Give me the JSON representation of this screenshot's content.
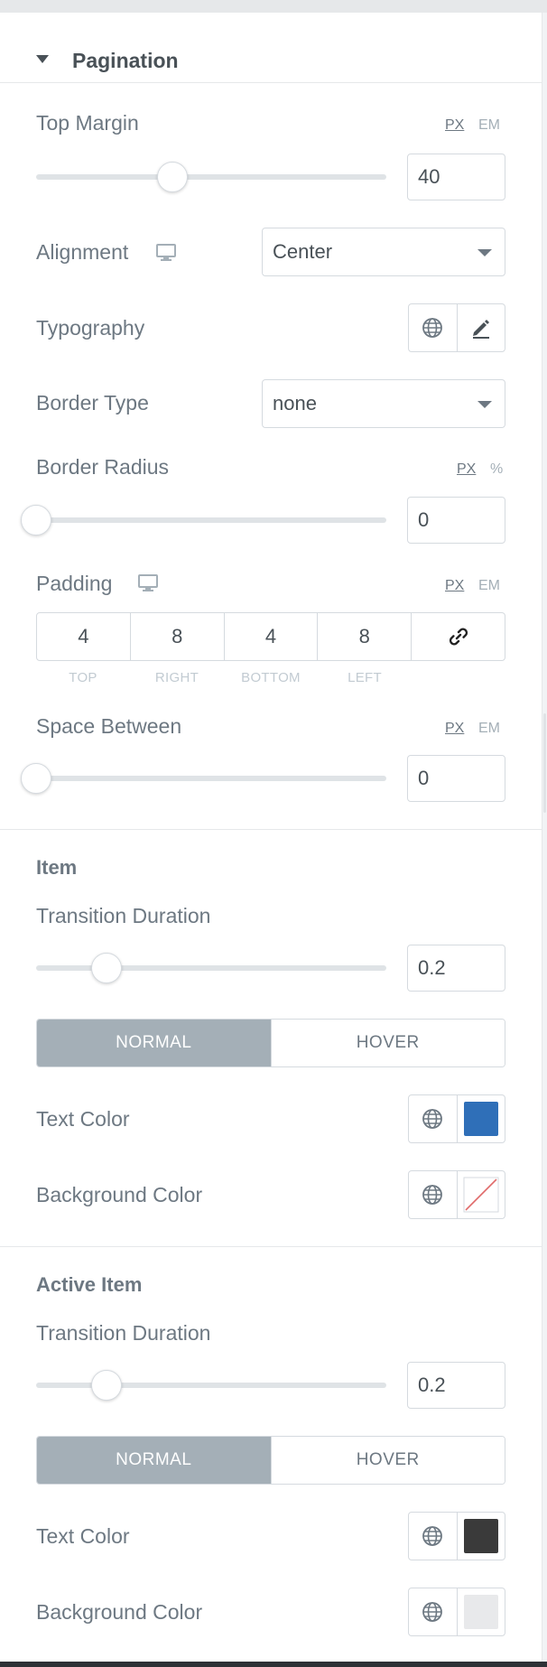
{
  "section": {
    "title": "Pagination"
  },
  "top_margin": {
    "label": "Top Margin",
    "units": [
      "PX",
      "EM"
    ],
    "active_unit": "PX",
    "value": "40",
    "slider_fraction": 0.39
  },
  "alignment": {
    "label": "Alignment",
    "device_icon": "desktop-icon",
    "value": "Center"
  },
  "typography": {
    "label": "Typography",
    "icons": [
      "globe-icon",
      "pencil-icon"
    ]
  },
  "border_type": {
    "label": "Border Type",
    "value": "none"
  },
  "border_radius": {
    "label": "Border Radius",
    "units": [
      "PX",
      "%"
    ],
    "active_unit": "PX",
    "value": "0",
    "slider_fraction": 0.0
  },
  "padding": {
    "label": "Padding",
    "device_icon": "desktop-icon",
    "units": [
      "PX",
      "EM"
    ],
    "active_unit": "PX",
    "values": [
      "4",
      "8",
      "4",
      "8"
    ],
    "sides": [
      "TOP",
      "RIGHT",
      "BOTTOM",
      "LEFT"
    ],
    "link_icon": "link-icon"
  },
  "space_between": {
    "label": "Space Between",
    "units": [
      "PX",
      "EM"
    ],
    "active_unit": "PX",
    "value": "0",
    "slider_fraction": 0.0
  },
  "item": {
    "heading": "Item",
    "transition": {
      "label": "Transition Duration",
      "value": "0.2",
      "slider_fraction": 0.2
    },
    "tabs": [
      "NORMAL",
      "HOVER"
    ],
    "active_tab": "NORMAL",
    "text_color": {
      "label": "Text Color",
      "color": "#2f6fb8"
    },
    "background_color": {
      "label": "Background Color",
      "color": "none"
    }
  },
  "active_item": {
    "heading": "Active Item",
    "transition": {
      "label": "Transition Duration",
      "value": "0.2",
      "slider_fraction": 0.2
    },
    "tabs": [
      "NORMAL",
      "HOVER"
    ],
    "active_tab": "NORMAL",
    "text_color": {
      "label": "Text Color",
      "color": "#3a3a3a"
    },
    "background_color": {
      "label": "Background Color",
      "color": "#e8e9eb"
    }
  }
}
